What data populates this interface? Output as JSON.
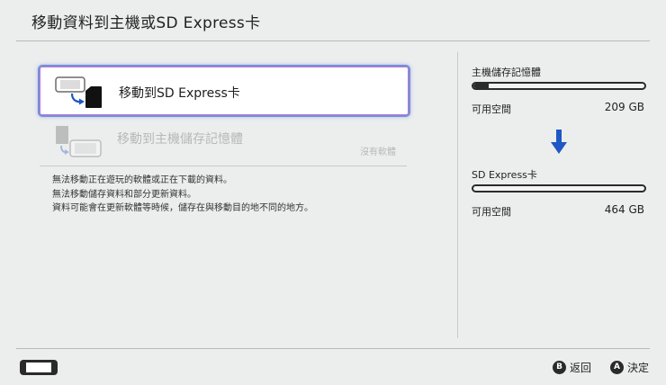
{
  "header": {
    "title": "移動資料到主機或SD Express卡"
  },
  "options": [
    {
      "label": "移動到SD Express卡",
      "note": "",
      "state": "selected",
      "icon": "console-to-sd-icon"
    },
    {
      "label": "移動到主機儲存記憶體",
      "note": "沒有軟體",
      "state": "disabled",
      "icon": "sd-to-console-icon"
    }
  ],
  "notes": [
    "無法移動正在遊玩的軟體或正在下載的資料。",
    "無法移動儲存資料和部分更新資料。",
    "資料可能會在更新軟體等時候，儲存在與移動目的地不同的地方。"
  ],
  "storage": {
    "source": {
      "title": "主機儲存記憶體",
      "free_label": "可用空間",
      "free_value": "209 GB",
      "used_fraction": 0.09
    },
    "arrow": "arrow-down-icon",
    "destination": {
      "title": "SD Express卡",
      "free_label": "可用空間",
      "free_value": "464 GB",
      "used_fraction": 0.0
    }
  },
  "footer": {
    "back": {
      "glyph": "B",
      "label": "返回"
    },
    "confirm": {
      "glyph": "A",
      "label": "決定"
    }
  },
  "colors": {
    "accent_arrow": "#1f57c4",
    "selection_border": "#6f93d8",
    "selection_glow": "#c86fd6"
  }
}
